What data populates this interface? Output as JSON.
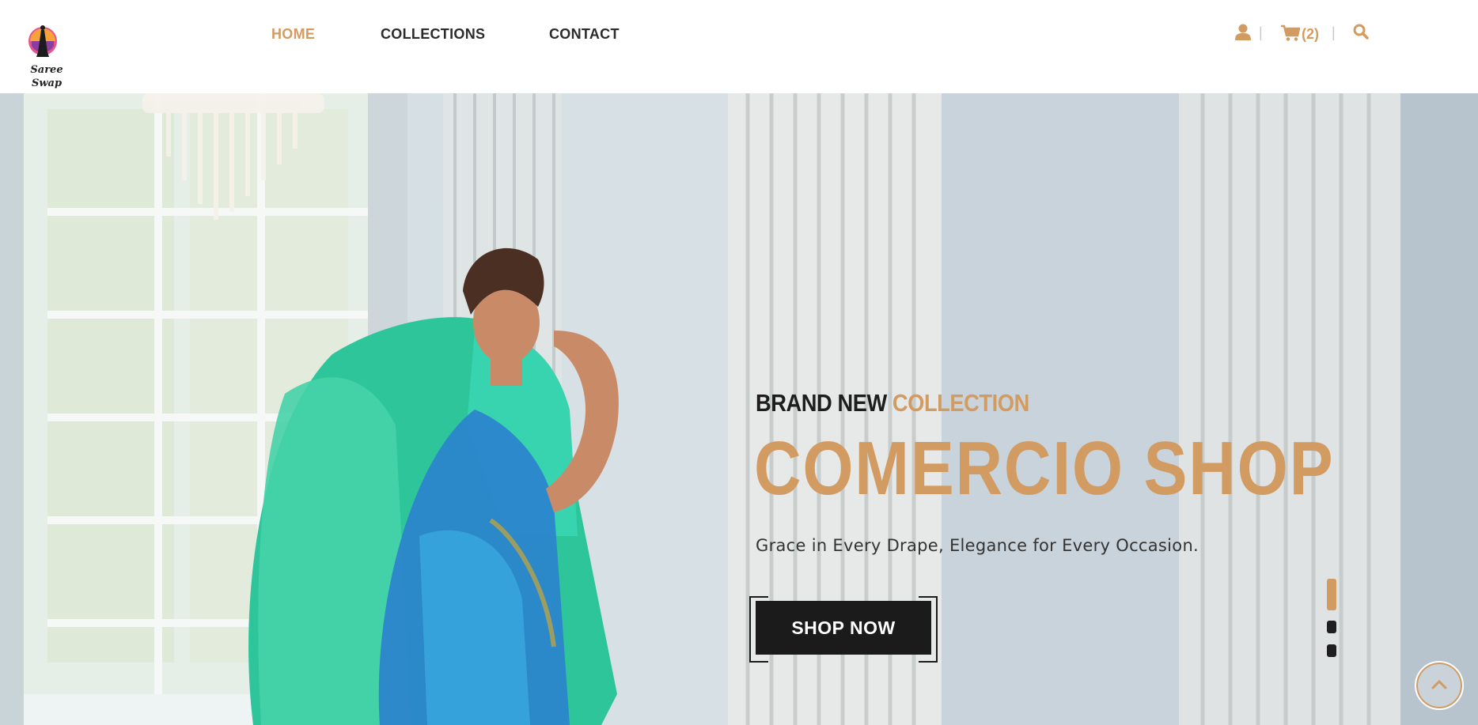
{
  "header": {
    "logo_text": [
      "Saree",
      "Swap"
    ],
    "nav": [
      {
        "label": "HOME",
        "active": true
      },
      {
        "label": "COLLECTIONS",
        "active": false
      },
      {
        "label": "CONTACT",
        "active": false
      }
    ],
    "icons": [
      "user-icon",
      "cart-icon",
      "search-icon"
    ],
    "cart_count": "(2)",
    "separator": "|"
  },
  "hero": {
    "eyebrow_dark": "BRAND NEW",
    "eyebrow_gold": "COLLECTION",
    "title": "COMERCIO SHOP",
    "tagline": "Grace in Every Drape, Elegance for Every Occasion.",
    "cta_label": "SHOP NOW",
    "slides": 3,
    "active_slide": 1
  },
  "colors": {
    "accent": "#d29b62",
    "dark": "#1b1b1b",
    "text": "#2b2b2b"
  }
}
